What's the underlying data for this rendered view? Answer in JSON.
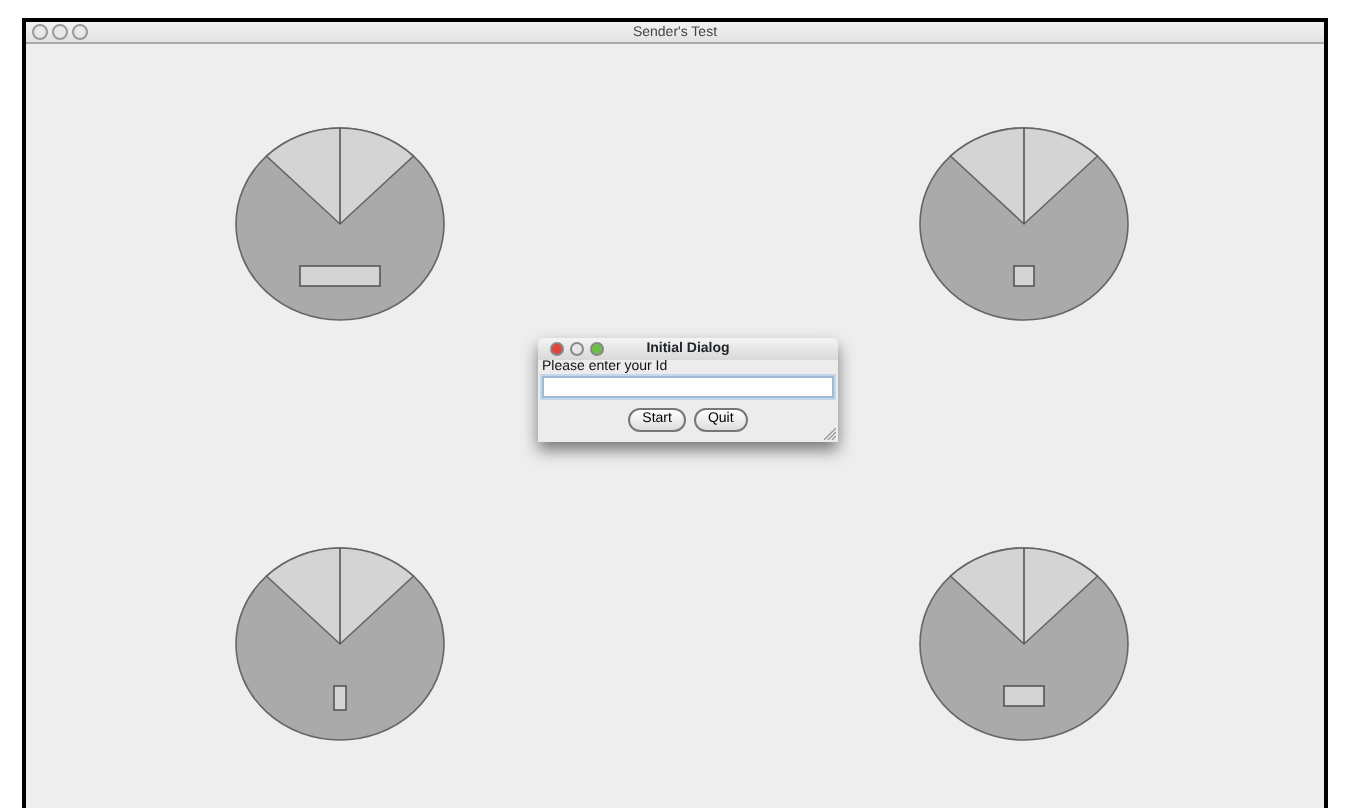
{
  "window": {
    "title": "Sender's Test"
  },
  "dialog": {
    "title": "Initial Dialog",
    "prompt": "Please enter your Id",
    "buttons": [
      "Start",
      "Quit"
    ]
  }
}
